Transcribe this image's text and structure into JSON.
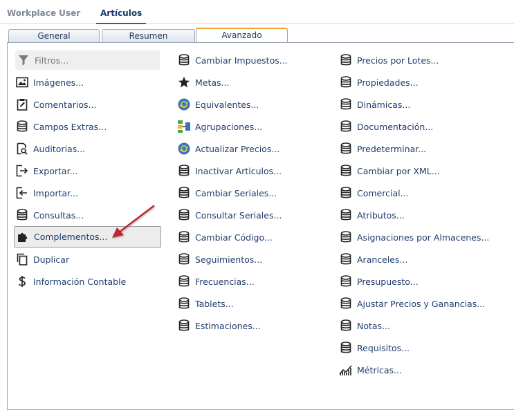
{
  "top_tabs": [
    {
      "label": "Workplace User",
      "active": false
    },
    {
      "label": "Artículos",
      "active": true
    }
  ],
  "inner_tabs": [
    {
      "label": "General"
    },
    {
      "label": "Resumen"
    },
    {
      "label": "Avanzado",
      "active": true
    }
  ],
  "filter": {
    "placeholder": "Filtros..."
  },
  "col1": [
    {
      "label": "Imágenes...",
      "icon": "image-icon"
    },
    {
      "label": "Comentarios...",
      "icon": "clipboard-edit-icon"
    },
    {
      "label": "Campos Extras...",
      "icon": "database-icon"
    },
    {
      "label": "Auditorias...",
      "icon": "file-search-icon"
    },
    {
      "label": "Exportar...",
      "icon": "export-icon"
    },
    {
      "label": "Importar...",
      "icon": "import-icon"
    },
    {
      "label": "Consultas...",
      "icon": "database-icon"
    },
    {
      "label": "Complementos...",
      "icon": "puzzle-icon"
    },
    {
      "label": "Duplicar",
      "icon": "copy-icon"
    },
    {
      "label": "Información Contable",
      "icon": "dollar-icon"
    }
  ],
  "col2": [
    {
      "label": "Cambiar Impuestos...",
      "icon": "database-icon"
    },
    {
      "label": "Metas...",
      "icon": "star-icon"
    },
    {
      "label": "Equivalentes...",
      "icon": "sync-icon"
    },
    {
      "label": "Agrupaciones...",
      "icon": "grouping-icon"
    },
    {
      "label": "Actualizar Precios...",
      "icon": "sync-icon"
    },
    {
      "label": "Inactivar Articulos...",
      "icon": "database-icon"
    },
    {
      "label": "Cambiar Seriales...",
      "icon": "database-icon"
    },
    {
      "label": "Consultar Seriales...",
      "icon": "database-icon"
    },
    {
      "label": "Cambiar Código...",
      "icon": "database-icon"
    },
    {
      "label": "Seguimientos...",
      "icon": "database-icon"
    },
    {
      "label": "Frecuencias...",
      "icon": "database-icon"
    },
    {
      "label": "Tablets...",
      "icon": "database-icon"
    },
    {
      "label": "Estimaciones...",
      "icon": "database-icon"
    }
  ],
  "col3": [
    {
      "label": "Precios por Lotes...",
      "icon": "database-icon"
    },
    {
      "label": "Propiedades...",
      "icon": "database-icon"
    },
    {
      "label": "Dinámicas...",
      "icon": "database-icon"
    },
    {
      "label": "Documentación...",
      "icon": "database-icon"
    },
    {
      "label": "Predeterminar...",
      "icon": "database-icon"
    },
    {
      "label": "Cambiar por XML...",
      "icon": "database-icon"
    },
    {
      "label": "Comercial...",
      "icon": "database-icon"
    },
    {
      "label": "Atributos...",
      "icon": "database-icon"
    },
    {
      "label": "Asignaciones por Almacenes...",
      "icon": "database-icon"
    },
    {
      "label": "Aranceles...",
      "icon": "database-icon"
    },
    {
      "label": "Presupuesto...",
      "icon": "database-icon"
    },
    {
      "label": "Ajustar Precios y Ganancias...",
      "icon": "database-icon"
    },
    {
      "label": "Notas...",
      "icon": "database-icon"
    },
    {
      "label": "Requisitos...",
      "icon": "database-icon"
    },
    {
      "label": "Métricas...",
      "icon": "chart-line-icon"
    }
  ],
  "colors": {
    "link": "#1f3d6b",
    "accent_tab": "#f0a030",
    "arrow": "#c0282d"
  }
}
